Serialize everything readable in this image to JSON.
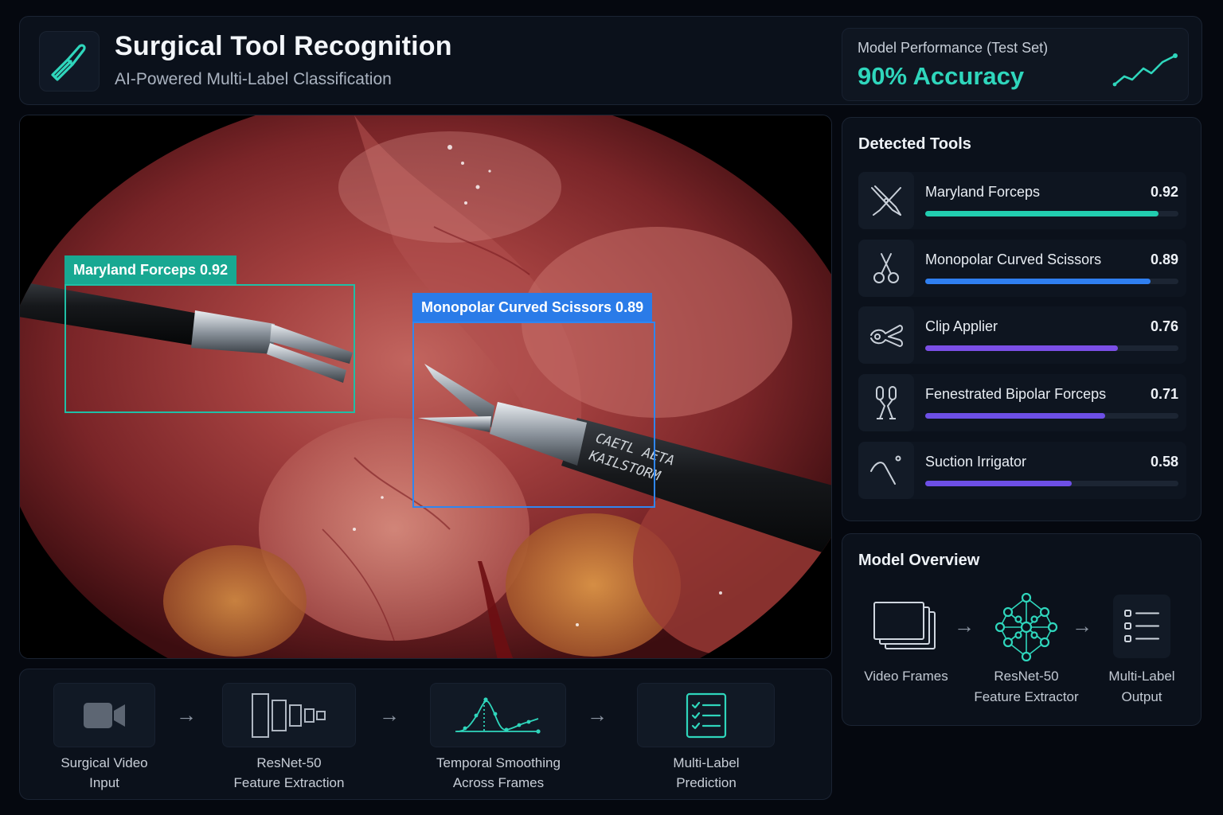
{
  "header": {
    "title": "Surgical Tool Recognition",
    "subtitle": "AI-Powered Multi-Label Classification",
    "icon": "scalpel-icon",
    "performance": {
      "label": "Model Performance (Test Set)",
      "value": "90% Accuracy",
      "icon": "trend-up-icon"
    }
  },
  "video": {
    "detections": [
      {
        "label": "Maryland Forceps 0.92",
        "color": "#1fbfa6"
      },
      {
        "label": "Monopolar Curved Scissors 0.89",
        "color": "#2f86f0"
      }
    ],
    "shaft_text": [
      "CAETL AETA",
      "KAILSTORM"
    ]
  },
  "detected_tools": {
    "title": "Detected Tools",
    "items": [
      {
        "name": "Maryland Forceps",
        "score": "0.92",
        "value": 0.92,
        "color": "#22cdb0",
        "icon": "forceps-icon"
      },
      {
        "name": "Monopolar Curved Scissors",
        "score": "0.89",
        "value": 0.89,
        "color": "#2f7ff0",
        "icon": "scissors-icon"
      },
      {
        "name": "Clip Applier",
        "score": "0.76",
        "value": 0.76,
        "color": "#7b4fe6",
        "icon": "clip-applier-icon"
      },
      {
        "name": "Fenestrated Bipolar Forceps",
        "score": "0.71",
        "value": 0.71,
        "color": "#6d4fe6",
        "icon": "bipolar-forceps-icon"
      },
      {
        "name": "Suction Irrigator",
        "score": "0.58",
        "value": 0.58,
        "color": "#6d4fe6",
        "icon": "suction-irrigator-icon"
      }
    ]
  },
  "model_overview": {
    "title": "Model Overview",
    "steps": [
      {
        "line1": "Video Frames",
        "line2": "",
        "icon": "frames-icon"
      },
      {
        "line1": "ResNet-50",
        "line2": "Feature Extractor",
        "icon": "neural-network-icon"
      },
      {
        "line1": "Multi-Label",
        "line2": "Output",
        "icon": "checklist-icon"
      }
    ]
  },
  "pipeline": {
    "steps": [
      {
        "line1": "Surgical Video",
        "line2": "Input",
        "icon": "video-camera-icon"
      },
      {
        "line1": "ResNet-50",
        "line2": "Feature Extraction",
        "icon": "feature-blocks-icon"
      },
      {
        "line1": "Temporal Smoothing",
        "line2": "Across Frames",
        "icon": "smoothing-curve-icon"
      },
      {
        "line1": "Multi-Label",
        "line2": "Prediction",
        "icon": "prediction-list-icon"
      }
    ]
  },
  "colors": {
    "accent": "#2fd6bc",
    "background": "#05080f",
    "panel": "#0b111b"
  }
}
